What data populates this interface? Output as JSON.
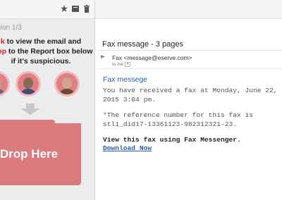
{
  "left_panel": {
    "toolbar_icons": [
      "star-icon",
      "archive-icon",
      "trash-icon"
    ],
    "question_label": "tion 1/3",
    "instructions": {
      "line1_red": "k",
      "line1_rest": " to view the email and",
      "line2_red": "Drop",
      "line2_rest": " to the Report box below",
      "line3": "if it's suspicious."
    },
    "drop_label": "Drop Here"
  },
  "email": {
    "subject": "Fax message - 3 pages",
    "from": "Fax <message@eserve.com>",
    "to": "to me",
    "title": "Fax messege",
    "body_line1": "You have received a fax at Monday, June 22,",
    "body_line2": "2015 3:04 pm.",
    "ref_line1": "*The reference number for this fax is",
    "ref_line2": "stl1_did17-13361123-982312321-23.",
    "view_line": "View this fax using Fax Messenger.",
    "download_link": "Download Now"
  },
  "colors": {
    "accent_red": "#d9202c",
    "drop_box": "#da7a7d",
    "link_blue": "#2a5db0"
  }
}
